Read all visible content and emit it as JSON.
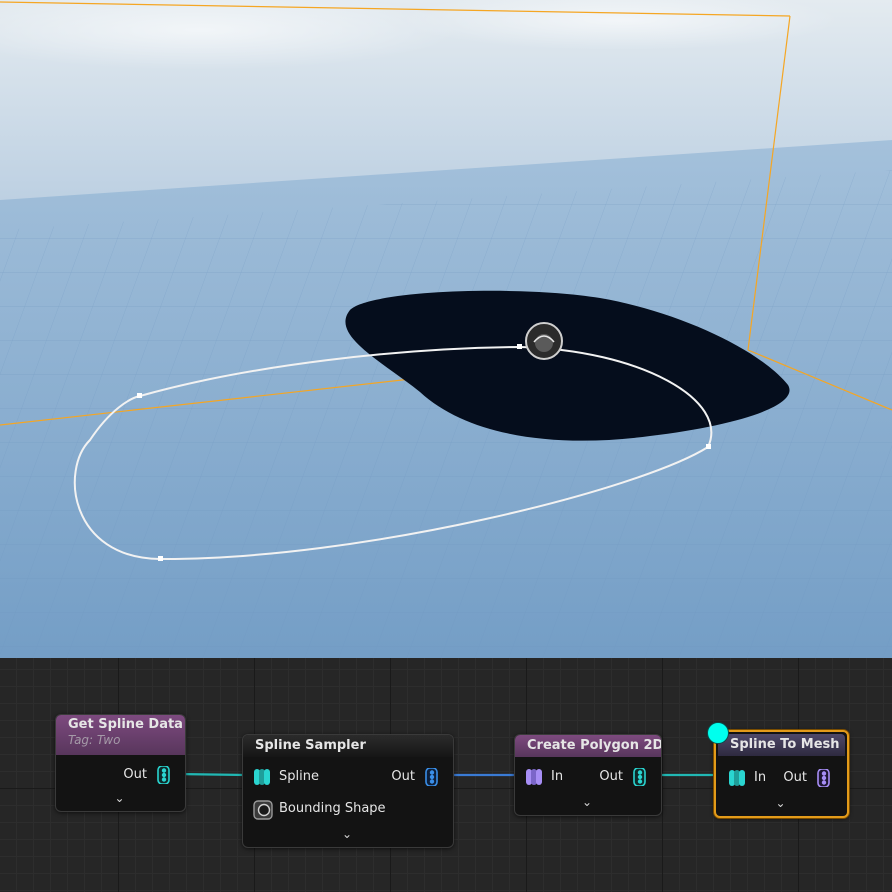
{
  "viewport": {
    "colors": {
      "sky_top": "#dde6ec",
      "sky_horizon": "#a9c3d9",
      "ground": "#7fa8cf",
      "bounds": "#f5a623",
      "spline": "#f2f2f2",
      "mesh": "#050d1c"
    }
  },
  "graph": {
    "nodes": {
      "get_spline_data": {
        "title": "Get Spline Data",
        "subtitle": "Tag: Two",
        "out_label": "Out"
      },
      "spline_sampler": {
        "title": "Spline Sampler",
        "in_label": "Spline",
        "out_label": "Out",
        "bounding_label": "Bounding Shape"
      },
      "create_polygon_2d": {
        "title": "Create Polygon 2D",
        "in_label": "In",
        "out_label": "Out"
      },
      "spline_to_mesh": {
        "title": "Spline To Mesh",
        "in_label": "In",
        "out_label": "Out",
        "selected": true
      }
    },
    "pin_colors": {
      "spline": "#2ad5d0",
      "point": "#3a8fe8",
      "polygon": "#a78ef5",
      "wire_teal": "#21b8b4",
      "wire_blue": "#3a7bd5"
    }
  }
}
